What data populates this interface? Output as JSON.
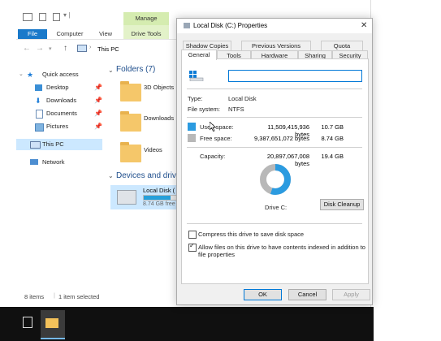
{
  "explorer": {
    "ribbon_tabs": [
      "File",
      "Computer",
      "View"
    ],
    "manage_label": "Manage",
    "drive_tools_label": "Drive Tools",
    "address": "This PC",
    "nav": {
      "quick_access": "Quick access",
      "desktop": "Desktop",
      "downloads": "Downloads",
      "documents": "Documents",
      "pictures": "Pictures",
      "this_pc": "This PC",
      "network": "Network"
    },
    "folders_header": "Folders (7)",
    "folders": [
      "3D Objects",
      "Downloads",
      "Videos"
    ],
    "devices_header": "Devices and driv",
    "drive_tile_name": "Local Disk (",
    "drive_tile_free": "8.74 GB free",
    "status_items": "8 items",
    "status_selected": "1 item selected"
  },
  "dialog": {
    "title": "Local Disk (C:) Properties",
    "close_glyph": "✕",
    "tabs_top": [
      "Shadow Copies",
      "Previous Versions",
      "Quota"
    ],
    "tabs_bottom": [
      "General",
      "Tools",
      "Hardware",
      "Sharing",
      "Security"
    ],
    "name_value": "",
    "type_label": "Type:",
    "type_value": "Local Disk",
    "fs_label": "File system:",
    "fs_value": "NTFS",
    "used_label": "Used space:",
    "used_bytes": "11,509,415,936 bytes",
    "used_gb": "10.7 GB",
    "free_label": "Free space:",
    "free_bytes": "9,387,651,072 bytes",
    "free_gb": "8.74 GB",
    "capacity_label": "Capacity:",
    "capacity_bytes": "20,897,067,008 bytes",
    "capacity_gb": "19.4 GB",
    "drive_label": "Drive C:",
    "disk_cleanup": "Disk Cleanup",
    "compress_label": "Compress this drive to save disk space",
    "compress_checked": false,
    "index_label_1": "Allow files on this drive to have contents indexed in addition to",
    "index_label_2": "file properties",
    "index_checked": true,
    "ok": "OK",
    "cancel": "Cancel",
    "apply": "Apply",
    "used_fraction": 0.551,
    "colors": {
      "used": "#2b9be0",
      "free": "#b8b8b8"
    }
  }
}
